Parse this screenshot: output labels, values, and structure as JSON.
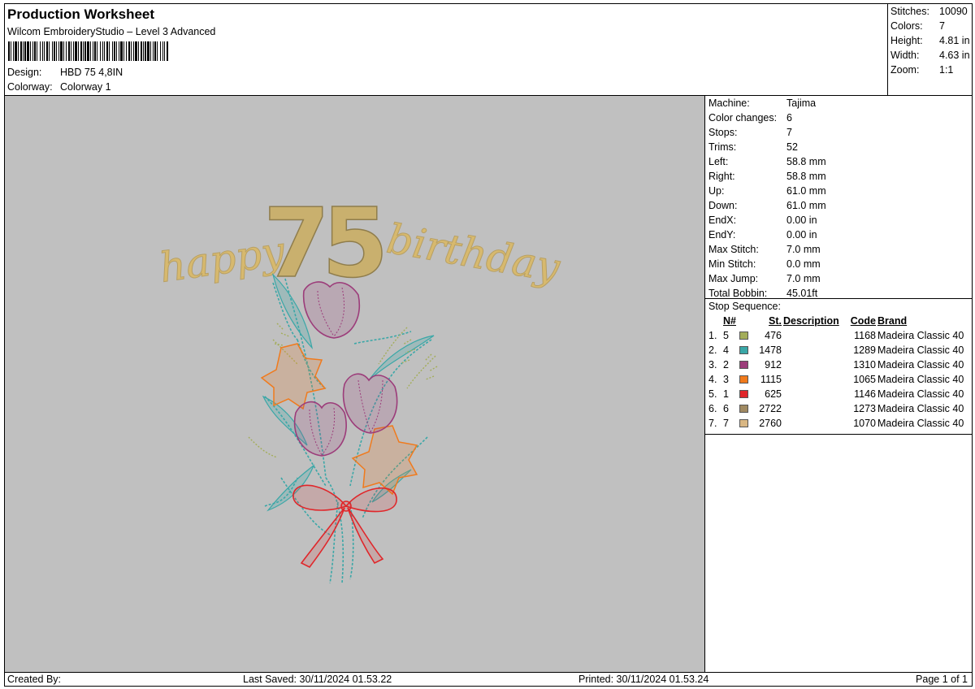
{
  "header": {
    "title": "Production Worksheet",
    "software": "Wilcom EmbroideryStudio – Level 3 Advanced",
    "design_label": "Design:",
    "design_value": "HBD 75 4,8IN",
    "colorway_label": "Colorway:",
    "colorway_value": "Colorway 1"
  },
  "summary": [
    {
      "label": "Stitches:",
      "value": "10090"
    },
    {
      "label": "Colors:",
      "value": "7"
    },
    {
      "label": "Height:",
      "value": "4.81 in"
    },
    {
      "label": "Width:",
      "value": "4.63 in"
    },
    {
      "label": "Zoom:",
      "value": "1:1"
    }
  ],
  "machine_info": [
    {
      "label": "Machine:",
      "value": "Tajima"
    },
    {
      "label": "Color changes:",
      "value": "6"
    },
    {
      "label": "Stops:",
      "value": "7"
    },
    {
      "label": "Trims:",
      "value": "52"
    },
    {
      "label": "Left:",
      "value": "58.8 mm"
    },
    {
      "label": "Right:",
      "value": "58.8 mm"
    },
    {
      "label": "Up:",
      "value": "61.0 mm"
    },
    {
      "label": "Down:",
      "value": "61.0 mm"
    },
    {
      "label": "EndX:",
      "value": "0.00 in"
    },
    {
      "label": "EndY:",
      "value": "0.00 in"
    },
    {
      "label": "Max Stitch:",
      "value": "7.0 mm"
    },
    {
      "label": "Min Stitch:",
      "value": "0.0 mm"
    },
    {
      "label": "Max Jump:",
      "value": "7.0 mm"
    },
    {
      "label": "Total Bobbin:",
      "value": "45.01ft"
    }
  ],
  "stop_sequence": {
    "caption": "Stop Sequence:",
    "headers": {
      "num": "N#",
      "st": "St.",
      "desc": "Description",
      "code": "Code",
      "brand": "Brand"
    },
    "rows": [
      {
        "seq": "1.",
        "num": "5",
        "color": "#a3ad5a",
        "st": "476",
        "desc": "",
        "code": "1168",
        "brand": "Madeira Classic 40"
      },
      {
        "seq": "2.",
        "num": "4",
        "color": "#3aa7a7",
        "st": "1478",
        "desc": "",
        "code": "1289",
        "brand": "Madeira Classic 40"
      },
      {
        "seq": "3.",
        "num": "2",
        "color": "#9c3c7a",
        "st": "912",
        "desc": "",
        "code": "1310",
        "brand": "Madeira Classic 40"
      },
      {
        "seq": "4.",
        "num": "3",
        "color": "#f07a1c",
        "st": "1115",
        "desc": "",
        "code": "1065",
        "brand": "Madeira Classic 40"
      },
      {
        "seq": "5.",
        "num": "1",
        "color": "#e0262a",
        "st": "625",
        "desc": "",
        "code": "1146",
        "brand": "Madeira Classic 40"
      },
      {
        "seq": "6.",
        "num": "6",
        "color": "#a08a62",
        "st": "2722",
        "desc": "",
        "code": "1273",
        "brand": "Madeira Classic 40"
      },
      {
        "seq": "7.",
        "num": "7",
        "color": "#d9b784",
        "st": "2760",
        "desc": "",
        "code": "1070",
        "brand": "Madeira Classic 40"
      }
    ]
  },
  "design_art": {
    "word_left": "happy",
    "number": "75",
    "word_right": "birthday",
    "background": "#c0c0c0",
    "gold": "#d7b96e",
    "gold_dark": "#b8a064"
  },
  "footer": {
    "created_by": "Created By:",
    "last_saved": "Last Saved: 30/11/2024 01.53.22",
    "printed": "Printed: 30/11/2024 01.53.24",
    "page": "Page 1 of 1"
  }
}
